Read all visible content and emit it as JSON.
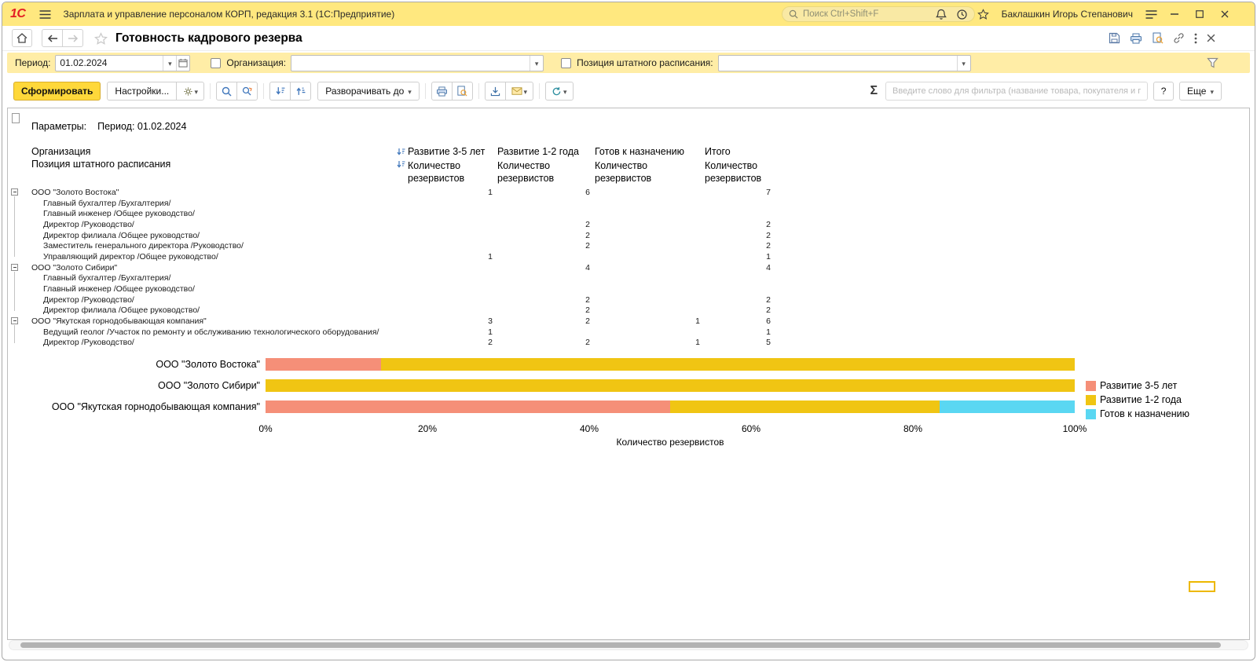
{
  "titlebar": {
    "app_title": "Зарплата и управление персоналом КОРП, редакция 3.1  (1С:Предприятие)",
    "search_placeholder": "Поиск Ctrl+Shift+F",
    "user_name": "Баклашкин Игорь Степанович"
  },
  "navbar": {
    "page_title": "Готовность кадрового резерва"
  },
  "filter_panel": {
    "period_label": "Период:",
    "period_value": "01.02.2024",
    "organization_label": "Организация:",
    "organization_value": "",
    "position_label": "Позиция штатного расписания:",
    "position_value": ""
  },
  "toolbar": {
    "generate_label": "Сформировать",
    "settings_label": "Настройки...",
    "expand_label": "Разворачивать до",
    "sigma": "Σ",
    "filter_placeholder": "Введите слово для фильтра (название товара, покупателя и пр.)",
    "help_label": "?",
    "more_label": "Еще"
  },
  "report": {
    "params_label": "Параметры:",
    "params_value": "Период: 01.02.2024",
    "header": {
      "col1_line1": "Организация",
      "col1_line2": "Позиция штатного расписания",
      "columns": [
        "Развитие 3-5 лет",
        "Развитие 1-2 года",
        "Готов к назначению",
        "Итого"
      ],
      "subheader": "Количество резервистов"
    },
    "rows": [
      {
        "label": "ООО \"Золото Востока\"",
        "level": 0,
        "values": [
          "1",
          "6",
          "",
          "7"
        ]
      },
      {
        "label": "Главный бухгалтер /Бухгалтерия/",
        "level": 1,
        "values": [
          "",
          "",
          "",
          ""
        ]
      },
      {
        "label": "Главный инженер /Общее руководство/",
        "level": 1,
        "values": [
          "",
          "",
          "",
          ""
        ]
      },
      {
        "label": "Директор /Руководство/",
        "level": 1,
        "values": [
          "",
          "2",
          "",
          "2"
        ]
      },
      {
        "label": "Директор филиала /Общее руководство/",
        "level": 1,
        "values": [
          "",
          "2",
          "",
          "2"
        ]
      },
      {
        "label": "Заместитель генерального директора /Руководство/",
        "level": 1,
        "values": [
          "",
          "2",
          "",
          "2"
        ]
      },
      {
        "label": "Управляющий директор /Общее руководство/",
        "level": 1,
        "values": [
          "1",
          "",
          "",
          "1"
        ]
      },
      {
        "label": "ООО \"Золото Сибири\"",
        "level": 0,
        "values": [
          "",
          "4",
          "",
          "4"
        ]
      },
      {
        "label": "Главный бухгалтер /Бухгалтерия/",
        "level": 1,
        "values": [
          "",
          "",
          "",
          ""
        ]
      },
      {
        "label": "Главный инженер /Общее руководство/",
        "level": 1,
        "values": [
          "",
          "",
          "",
          ""
        ]
      },
      {
        "label": "Директор /Руководство/",
        "level": 1,
        "values": [
          "",
          "2",
          "",
          "2"
        ]
      },
      {
        "label": "Директор филиала /Общее руководство/",
        "level": 1,
        "values": [
          "",
          "2",
          "",
          "2"
        ]
      },
      {
        "label": "ООО \"Якутская горнодобывающая компания\"",
        "level": 0,
        "values": [
          "3",
          "2",
          "1",
          "6"
        ]
      },
      {
        "label": "Ведущий геолог /Участок по ремонту и обслуживанию технологического оборудования/",
        "level": 1,
        "values": [
          "1",
          "",
          "",
          "1"
        ]
      },
      {
        "label": "Директор /Руководство/",
        "level": 1,
        "values": [
          "2",
          "2",
          "1",
          "5"
        ]
      }
    ]
  },
  "chart_data": {
    "type": "bar",
    "stacked": true,
    "orientation": "horizontal",
    "xlabel": "Количество резервистов",
    "x_ticks": [
      "0%",
      "20%",
      "40%",
      "60%",
      "80%",
      "100%"
    ],
    "xlim": [
      0,
      100
    ],
    "legend_position": "right",
    "categories": [
      "ООО \"Золото Востока\"",
      "ООО \"Золото Сибири\"",
      "ООО \"Якутская горнодобывающая компания\""
    ],
    "series": [
      {
        "name": "Развитие 3-5 лет",
        "color": "#f58f78",
        "counts": [
          1,
          0,
          3
        ],
        "values_pct": [
          14.29,
          0,
          50
        ]
      },
      {
        "name": "Развитие 1-2 года",
        "color": "#f0c513",
        "counts": [
          6,
          4,
          2
        ],
        "values_pct": [
          85.71,
          100,
          33.33
        ]
      },
      {
        "name": "Готов к назначению",
        "color": "#5ad7f2",
        "counts": [
          0,
          0,
          1
        ],
        "values_pct": [
          0,
          0,
          16.67
        ]
      }
    ]
  }
}
